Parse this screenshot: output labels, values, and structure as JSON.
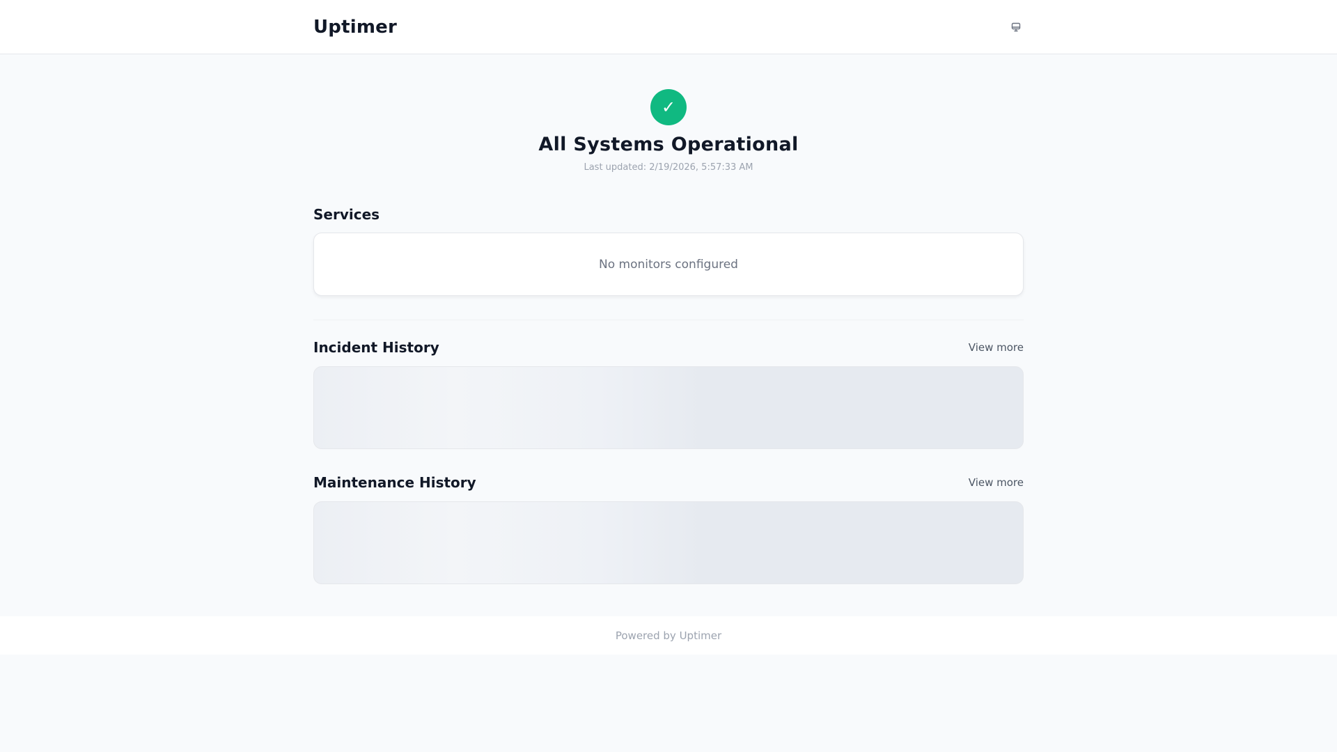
{
  "header": {
    "brand": "Uptimer",
    "theme_toggle_icon": "monitor-icon"
  },
  "status": {
    "icon": "check-icon",
    "symbol": "✓",
    "title": "All Systems Operational",
    "updated": "Last updated: 2/19/2026, 5:57:33 AM",
    "color": "#10b981"
  },
  "services": {
    "title": "Services",
    "empty_text": "No monitors configured"
  },
  "incidents": {
    "title": "Incident History",
    "view_more": "View more"
  },
  "maintenance": {
    "title": "Maintenance History",
    "view_more": "View more"
  },
  "footer": {
    "text": "Powered by Uptimer"
  }
}
